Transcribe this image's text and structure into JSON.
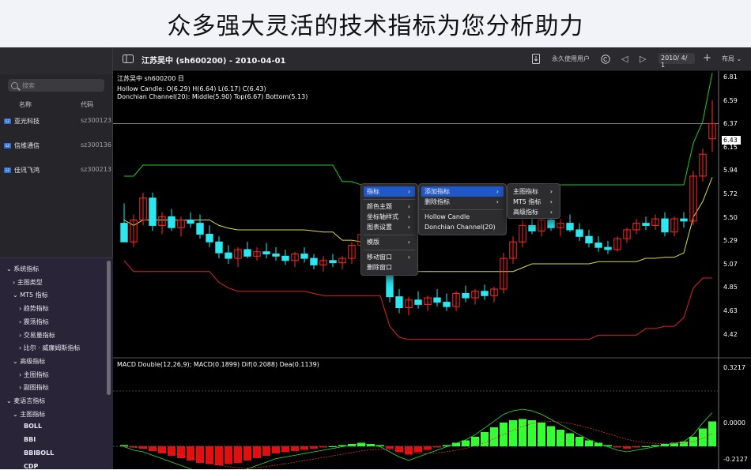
{
  "banner": {
    "text": "众多强大灵活的技术指标为您分析助力"
  },
  "toolbar": {
    "title": "江苏吴中 (sh600200) - 2010-04-01",
    "user_label": "永久使用用户",
    "date_value": "2010/ 4/ 1",
    "layout_label": "布局 ⌄"
  },
  "sidebar": {
    "search_placeholder": "搜索",
    "col_name": "名称",
    "col_code": "代码",
    "stocks": [
      {
        "badge": "SZ",
        "name": "亚光科技",
        "code": "sz300123"
      },
      {
        "badge": "SZ",
        "name": "信维通信",
        "code": "sz300136"
      },
      {
        "badge": "SZ",
        "name": "佳讯飞鸿",
        "code": "sz300213"
      }
    ],
    "tree": [
      {
        "label": "⌄ 系统指标"
      },
      {
        "label": "› 主图类型"
      },
      {
        "label": "⌄ MT5 指标"
      },
      {
        "label": "› 趋势指标"
      },
      {
        "label": "› 震荡指标"
      },
      {
        "label": "› 交易量指标"
      },
      {
        "label": "› 比尔 · 威廉姆斯指标"
      },
      {
        "label": "⌄ 高级指标"
      },
      {
        "label": "› 主图指标"
      },
      {
        "label": "› 副图指标"
      },
      {
        "label": "⌄ 麦语言指标"
      },
      {
        "label": "⌄ 主图指标"
      },
      {
        "label": "BOLL"
      },
      {
        "label": "BBI"
      },
      {
        "label": "BBIBOLL"
      },
      {
        "label": "CDP"
      }
    ]
  },
  "chart": {
    "header": "江苏吴中 sh600200   日",
    "hollow": "Hollow Candle: O(6.29) H(6.64) L(6.17) C(6.43)",
    "donchian": "Donchian Channel(20): Middle(5.90) Top(6.67) Bottom(5.13)",
    "macd": "MACD Double(12,26,9); MACD(0.1899) Dif(0.2088) Dea(0.1139)",
    "price_axis": [
      "6.81",
      "6.59",
      "6.37",
      "6.15",
      "5.94",
      "5.72",
      "5.50",
      "5.29",
      "5.07",
      "4.85",
      "4.63",
      "4.42"
    ],
    "current_price": "6.43",
    "macd_axis": [
      "0.3217",
      "0.0000",
      "-0.2127"
    ]
  },
  "context_menu": {
    "main": [
      {
        "label": "指标",
        "arrow": "›"
      },
      {
        "label": "颜色主题",
        "arrow": "›"
      },
      {
        "label": "坐标轴样式",
        "arrow": "›"
      },
      {
        "label": "图表设置",
        "arrow": "›"
      },
      {
        "label": "模版",
        "arrow": "›"
      },
      {
        "label": "移动窗口",
        "arrow": "›"
      },
      {
        "label": "删除窗口",
        "arrow": ""
      }
    ],
    "sub1": [
      {
        "label": "添加指标",
        "arrow": "›"
      },
      {
        "label": "删除指标",
        "arrow": "›"
      },
      {
        "label": "Hollow Candle",
        "arrow": ""
      },
      {
        "label": "Donchian Channel(20)",
        "arrow": ""
      }
    ],
    "sub2": [
      {
        "label": "主图指标",
        "arrow": "›"
      },
      {
        "label": "MT5 指标",
        "arrow": "›"
      },
      {
        "label": "高级指标",
        "arrow": "›"
      }
    ]
  },
  "colors": {
    "up": "#ff2a2a",
    "down": "#2ee6f0",
    "macd_up": "#33ff33",
    "macd_down": "#e01010",
    "accent": "#2058c8"
  },
  "candles": [
    [
      5.52,
      5.7,
      5.4,
      5.35
    ],
    [
      5.35,
      5.6,
      5.3,
      5.55
    ],
    [
      5.55,
      5.8,
      5.5,
      5.75
    ],
    [
      5.75,
      5.8,
      5.45,
      5.5
    ],
    [
      5.5,
      5.62,
      5.42,
      5.58
    ],
    [
      5.58,
      5.65,
      5.45,
      5.48
    ],
    [
      5.48,
      5.58,
      5.4,
      5.55
    ],
    [
      5.55,
      5.62,
      5.48,
      5.52
    ],
    [
      5.52,
      5.6,
      5.38,
      5.42
    ],
    [
      5.42,
      5.5,
      5.3,
      5.35
    ],
    [
      5.35,
      5.4,
      5.2,
      5.25
    ],
    [
      5.25,
      5.32,
      5.15,
      5.2
    ],
    [
      5.2,
      5.3,
      5.12,
      5.28
    ],
    [
      5.28,
      5.35,
      5.2,
      5.22
    ],
    [
      5.22,
      5.3,
      5.18,
      5.26
    ],
    [
      5.26,
      5.34,
      5.2,
      5.24
    ],
    [
      5.24,
      5.3,
      5.18,
      5.22
    ],
    [
      5.22,
      5.28,
      5.14,
      5.18
    ],
    [
      5.18,
      5.26,
      5.12,
      5.24
    ],
    [
      5.24,
      5.3,
      5.16,
      5.2
    ],
    [
      5.2,
      5.24,
      5.1,
      5.14
    ],
    [
      5.14,
      5.22,
      5.08,
      5.18
    ],
    [
      5.18,
      5.24,
      5.12,
      5.16
    ],
    [
      5.16,
      5.22,
      5.1,
      5.2
    ],
    [
      5.2,
      5.35,
      5.15,
      5.32
    ],
    [
      5.32,
      5.45,
      5.28,
      5.42
    ],
    [
      5.42,
      5.48,
      5.3,
      5.34
    ],
    [
      5.34,
      5.4,
      5.2,
      5.24
    ],
    [
      5.24,
      5.3,
      4.8,
      4.85
    ],
    [
      4.85,
      4.92,
      4.7,
      4.75
    ],
    [
      4.75,
      4.85,
      4.68,
      4.82
    ],
    [
      4.82,
      4.9,
      4.74,
      4.78
    ],
    [
      4.78,
      4.86,
      4.72,
      4.84
    ],
    [
      4.84,
      4.92,
      4.76,
      4.8
    ],
    [
      4.8,
      4.88,
      4.72,
      4.76
    ],
    [
      4.76,
      4.9,
      4.72,
      4.88
    ],
    [
      4.88,
      4.95,
      4.8,
      4.84
    ],
    [
      4.84,
      4.92,
      4.78,
      4.9
    ],
    [
      4.9,
      4.96,
      4.82,
      4.86
    ],
    [
      4.86,
      4.94,
      4.8,
      4.92
    ],
    [
      4.92,
      5.25,
      4.88,
      5.2
    ],
    [
      5.2,
      5.4,
      5.15,
      5.35
    ],
    [
      5.35,
      5.55,
      5.3,
      5.5
    ],
    [
      5.5,
      5.62,
      5.42,
      5.45
    ],
    [
      5.45,
      5.58,
      5.4,
      5.55
    ],
    [
      5.55,
      5.62,
      5.45,
      5.48
    ],
    [
      5.48,
      5.56,
      5.4,
      5.52
    ],
    [
      5.52,
      5.6,
      5.44,
      5.46
    ],
    [
      5.46,
      5.52,
      5.36,
      5.4
    ],
    [
      5.4,
      5.46,
      5.3,
      5.34
    ],
    [
      5.34,
      5.4,
      5.26,
      5.3
    ],
    [
      5.3,
      5.36,
      5.24,
      5.28
    ],
    [
      5.28,
      5.4,
      5.26,
      5.38
    ],
    [
      5.38,
      5.48,
      5.34,
      5.46
    ],
    [
      5.46,
      5.56,
      5.42,
      5.52
    ],
    [
      5.52,
      5.58,
      5.46,
      5.5
    ],
    [
      5.5,
      5.6,
      5.46,
      5.56
    ],
    [
      5.56,
      5.62,
      5.4,
      5.44
    ],
    [
      5.44,
      5.58,
      5.4,
      5.56
    ],
    [
      5.56,
      5.62,
      5.48,
      5.54
    ],
    [
      5.54,
      6.0,
      5.5,
      5.95
    ],
    [
      5.95,
      6.2,
      5.9,
      6.15
    ],
    [
      6.29,
      6.64,
      6.17,
      6.43
    ]
  ],
  "macd_hist": [
    0.01,
    -0.01,
    -0.02,
    -0.04,
    -0.06,
    -0.08,
    -0.1,
    -0.12,
    -0.14,
    -0.15,
    -0.16,
    -0.15,
    -0.14,
    -0.12,
    -0.1,
    -0.08,
    -0.06,
    -0.05,
    -0.04,
    -0.03,
    -0.02,
    -0.01,
    0.0,
    0.01,
    0.02,
    0.03,
    0.02,
    0.01,
    -0.02,
    -0.05,
    -0.07,
    -0.05,
    -0.03,
    -0.01,
    0.01,
    0.03,
    0.05,
    0.08,
    0.12,
    0.16,
    0.2,
    0.22,
    0.23,
    0.22,
    0.2,
    0.17,
    0.14,
    0.11,
    0.08,
    0.05,
    0.03,
    0.01,
    -0.01,
    -0.02,
    -0.01,
    0.0,
    0.01,
    0.02,
    0.03,
    0.04,
    0.08,
    0.15,
    0.21
  ]
}
